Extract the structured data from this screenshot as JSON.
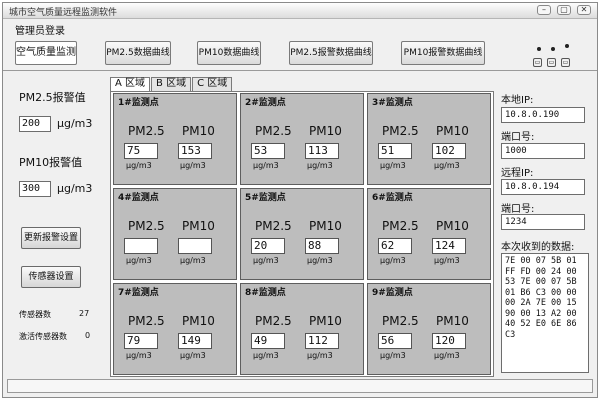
{
  "window": {
    "title": "城市空气质量远程监测软件",
    "controls": [
      "–",
      "▢",
      "✕"
    ]
  },
  "menubar": {
    "item": "管理员登录"
  },
  "toolbar": {
    "buttons": [
      "空气质量监测",
      "PM2.5数据曲线",
      "PM10数据曲线",
      "PM2.5报警数据曲线",
      "PM10报警数据曲线"
    ]
  },
  "left": {
    "pm25_alarm_label": "PM2.5报警值",
    "pm25_alarm_value": "200",
    "pm10_alarm_label": "PM10报警值",
    "pm10_alarm_value": "300",
    "unit": "μg/m3",
    "update_alarm_button": "更新报警设置",
    "sensor_settings_button": "传感器设置",
    "sensor_count_label": "传感器数",
    "sensor_count": "27",
    "active_sensor_label": "激活传感器数",
    "active_sensor_count": "0"
  },
  "tabs": [
    "A 区域",
    "B 区域",
    "C 区域"
  ],
  "grid": {
    "pm25_label": "PM2.5",
    "pm10_label": "PM10",
    "unit": "μg/m3",
    "cells": [
      {
        "title": "1#监测点",
        "pm25": "75",
        "pm10": "153"
      },
      {
        "title": "2#监测点",
        "pm25": "53",
        "pm10": "113"
      },
      {
        "title": "3#监测点",
        "pm25": "51",
        "pm10": "102"
      },
      {
        "title": "4#监测点",
        "pm25": "",
        "pm10": ""
      },
      {
        "title": "5#监测点",
        "pm25": "20",
        "pm10": "88"
      },
      {
        "title": "6#监测点",
        "pm25": "62",
        "pm10": "124"
      },
      {
        "title": "7#监测点",
        "pm25": "79",
        "pm10": "149"
      },
      {
        "title": "8#监测点",
        "pm25": "49",
        "pm10": "112"
      },
      {
        "title": "9#监测点",
        "pm25": "56",
        "pm10": "120"
      }
    ]
  },
  "right": {
    "local_ip_label": "本地IP:",
    "local_ip": "10.8.0.190",
    "local_port_label": "端口号:",
    "local_port": "1000",
    "remote_ip_label": "远程IP:",
    "remote_ip": "10.8.0.194",
    "remote_port_label": "端口号:",
    "remote_port": "1234",
    "received_label": "本次收到的数据:",
    "received_data": "7E 00 07 5B 01 FF FD 00 24 00 53 7E 00 07 5B 01 B6 C3 00 00 00 2A 7E 00 15 90 00 13 A2 00 40 52 E0 6E 86 C3"
  }
}
